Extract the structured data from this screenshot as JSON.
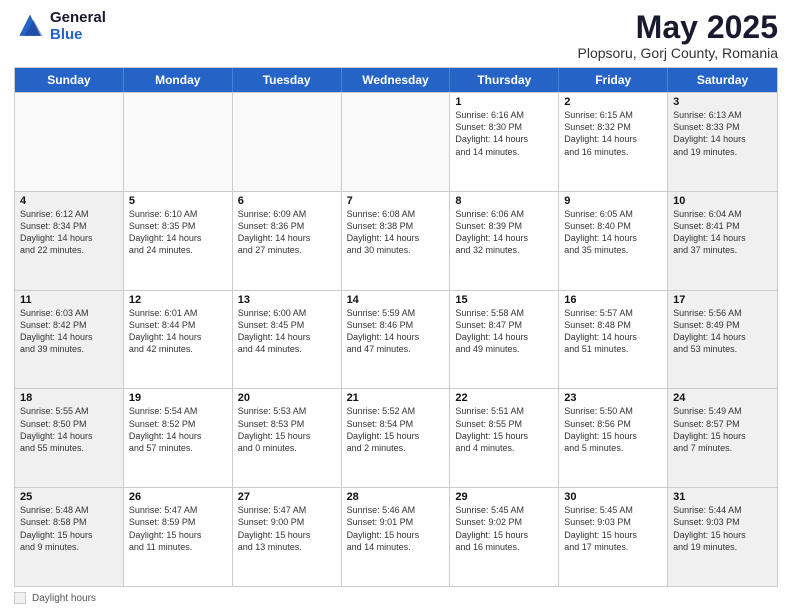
{
  "logo": {
    "general": "General",
    "blue": "Blue"
  },
  "title": {
    "month": "May 2025",
    "location": "Plopsoru, Gorj County, Romania"
  },
  "days": [
    "Sunday",
    "Monday",
    "Tuesday",
    "Wednesday",
    "Thursday",
    "Friday",
    "Saturday"
  ],
  "weeks": [
    [
      {
        "day": "",
        "empty": true
      },
      {
        "day": "",
        "empty": true
      },
      {
        "day": "",
        "empty": true
      },
      {
        "day": "",
        "empty": true
      },
      {
        "day": "1",
        "info": "Sunrise: 6:16 AM\nSunset: 8:30 PM\nDaylight: 14 hours\nand 14 minutes."
      },
      {
        "day": "2",
        "info": "Sunrise: 6:15 AM\nSunset: 8:32 PM\nDaylight: 14 hours\nand 16 minutes."
      },
      {
        "day": "3",
        "info": "Sunrise: 6:13 AM\nSunset: 8:33 PM\nDaylight: 14 hours\nand 19 minutes.",
        "shaded": true
      }
    ],
    [
      {
        "day": "4",
        "info": "Sunrise: 6:12 AM\nSunset: 8:34 PM\nDaylight: 14 hours\nand 22 minutes.",
        "shaded": true
      },
      {
        "day": "5",
        "info": "Sunrise: 6:10 AM\nSunset: 8:35 PM\nDaylight: 14 hours\nand 24 minutes."
      },
      {
        "day": "6",
        "info": "Sunrise: 6:09 AM\nSunset: 8:36 PM\nDaylight: 14 hours\nand 27 minutes."
      },
      {
        "day": "7",
        "info": "Sunrise: 6:08 AM\nSunset: 8:38 PM\nDaylight: 14 hours\nand 30 minutes."
      },
      {
        "day": "8",
        "info": "Sunrise: 6:06 AM\nSunset: 8:39 PM\nDaylight: 14 hours\nand 32 minutes."
      },
      {
        "day": "9",
        "info": "Sunrise: 6:05 AM\nSunset: 8:40 PM\nDaylight: 14 hours\nand 35 minutes."
      },
      {
        "day": "10",
        "info": "Sunrise: 6:04 AM\nSunset: 8:41 PM\nDaylight: 14 hours\nand 37 minutes.",
        "shaded": true
      }
    ],
    [
      {
        "day": "11",
        "info": "Sunrise: 6:03 AM\nSunset: 8:42 PM\nDaylight: 14 hours\nand 39 minutes.",
        "shaded": true
      },
      {
        "day": "12",
        "info": "Sunrise: 6:01 AM\nSunset: 8:44 PM\nDaylight: 14 hours\nand 42 minutes."
      },
      {
        "day": "13",
        "info": "Sunrise: 6:00 AM\nSunset: 8:45 PM\nDaylight: 14 hours\nand 44 minutes."
      },
      {
        "day": "14",
        "info": "Sunrise: 5:59 AM\nSunset: 8:46 PM\nDaylight: 14 hours\nand 47 minutes."
      },
      {
        "day": "15",
        "info": "Sunrise: 5:58 AM\nSunset: 8:47 PM\nDaylight: 14 hours\nand 49 minutes."
      },
      {
        "day": "16",
        "info": "Sunrise: 5:57 AM\nSunset: 8:48 PM\nDaylight: 14 hours\nand 51 minutes."
      },
      {
        "day": "17",
        "info": "Sunrise: 5:56 AM\nSunset: 8:49 PM\nDaylight: 14 hours\nand 53 minutes.",
        "shaded": true
      }
    ],
    [
      {
        "day": "18",
        "info": "Sunrise: 5:55 AM\nSunset: 8:50 PM\nDaylight: 14 hours\nand 55 minutes.",
        "shaded": true
      },
      {
        "day": "19",
        "info": "Sunrise: 5:54 AM\nSunset: 8:52 PM\nDaylight: 14 hours\nand 57 minutes."
      },
      {
        "day": "20",
        "info": "Sunrise: 5:53 AM\nSunset: 8:53 PM\nDaylight: 15 hours\nand 0 minutes."
      },
      {
        "day": "21",
        "info": "Sunrise: 5:52 AM\nSunset: 8:54 PM\nDaylight: 15 hours\nand 2 minutes."
      },
      {
        "day": "22",
        "info": "Sunrise: 5:51 AM\nSunset: 8:55 PM\nDaylight: 15 hours\nand 4 minutes."
      },
      {
        "day": "23",
        "info": "Sunrise: 5:50 AM\nSunset: 8:56 PM\nDaylight: 15 hours\nand 5 minutes."
      },
      {
        "day": "24",
        "info": "Sunrise: 5:49 AM\nSunset: 8:57 PM\nDaylight: 15 hours\nand 7 minutes.",
        "shaded": true
      }
    ],
    [
      {
        "day": "25",
        "info": "Sunrise: 5:48 AM\nSunset: 8:58 PM\nDaylight: 15 hours\nand 9 minutes.",
        "shaded": true
      },
      {
        "day": "26",
        "info": "Sunrise: 5:47 AM\nSunset: 8:59 PM\nDaylight: 15 hours\nand 11 minutes."
      },
      {
        "day": "27",
        "info": "Sunrise: 5:47 AM\nSunset: 9:00 PM\nDaylight: 15 hours\nand 13 minutes."
      },
      {
        "day": "28",
        "info": "Sunrise: 5:46 AM\nSunset: 9:01 PM\nDaylight: 15 hours\nand 14 minutes."
      },
      {
        "day": "29",
        "info": "Sunrise: 5:45 AM\nSunset: 9:02 PM\nDaylight: 15 hours\nand 16 minutes."
      },
      {
        "day": "30",
        "info": "Sunrise: 5:45 AM\nSunset: 9:03 PM\nDaylight: 15 hours\nand 17 minutes."
      },
      {
        "day": "31",
        "info": "Sunrise: 5:44 AM\nSunset: 9:03 PM\nDaylight: 15 hours\nand 19 minutes.",
        "shaded": true
      }
    ]
  ],
  "footer": {
    "legend_label": "Daylight hours"
  }
}
